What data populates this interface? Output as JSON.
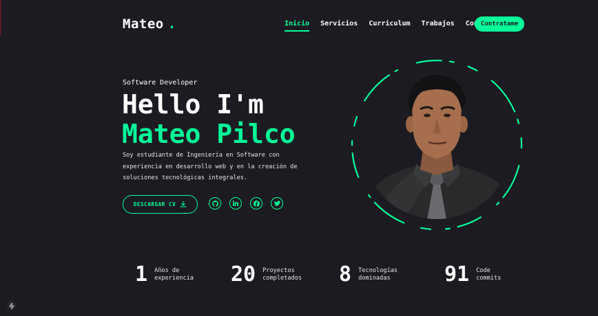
{
  "brand": {
    "name": "Mateo",
    "dot": "."
  },
  "nav": {
    "items": [
      {
        "label": "Inicio",
        "active": true
      },
      {
        "label": "Servicios",
        "active": false
      },
      {
        "label": "Curriculum",
        "active": false
      },
      {
        "label": "Trabajos",
        "active": false
      },
      {
        "label": "Contacto",
        "active": false
      }
    ],
    "cta_label": "Contratame"
  },
  "hero": {
    "role": "Software Developer",
    "greeting": "Hello I'm",
    "name": "Mateo Pilco",
    "description": "Soy estudiante de Ingeniería en Software con experiencia en desarrollo web y en la creación de soluciones tecnológicas integrales.",
    "cv_button": "DESCARGAR CV",
    "socials": [
      "github-icon",
      "linkedin-icon",
      "facebook-icon",
      "twitter-icon"
    ]
  },
  "stats": [
    {
      "value": "1",
      "label": "Años de experiencia"
    },
    {
      "value": "20",
      "label": "Proyectos completados"
    },
    {
      "value": "8",
      "label": "Tecnologías dominadas"
    },
    {
      "value": "91",
      "label": "Code commits"
    }
  ],
  "colors": {
    "accent": "#00ff99",
    "background": "#1c1b22"
  }
}
